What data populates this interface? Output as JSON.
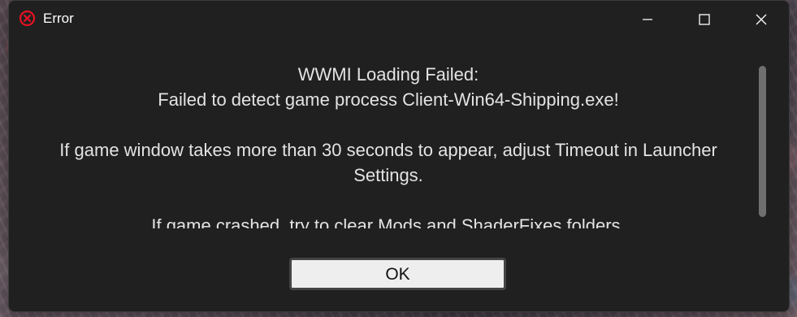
{
  "window": {
    "title": "Error",
    "title_icon": "error-circle-x-icon",
    "controls": {
      "minimize_icon": "minimize-icon",
      "maximize_icon": "maximize-icon",
      "close_icon": "close-icon"
    },
    "accent_error": "#e81123"
  },
  "message": {
    "lines": [
      "WWMI Loading Failed:",
      "Failed to detect game process Client-Win64-Shipping.exe!",
      "",
      "If game window takes more than 30 seconds to appear, adjust Timeout in Launcher",
      "Settings.",
      "",
      "If game crashed, try to clear Mods and ShaderFixes folders."
    ]
  },
  "footer": {
    "ok_label": "OK"
  },
  "colors": {
    "window_bg": "#202020",
    "text": "#e3e3e3",
    "button_bg": "#eeeeee",
    "scroll_thumb": "#6f6f6f"
  }
}
